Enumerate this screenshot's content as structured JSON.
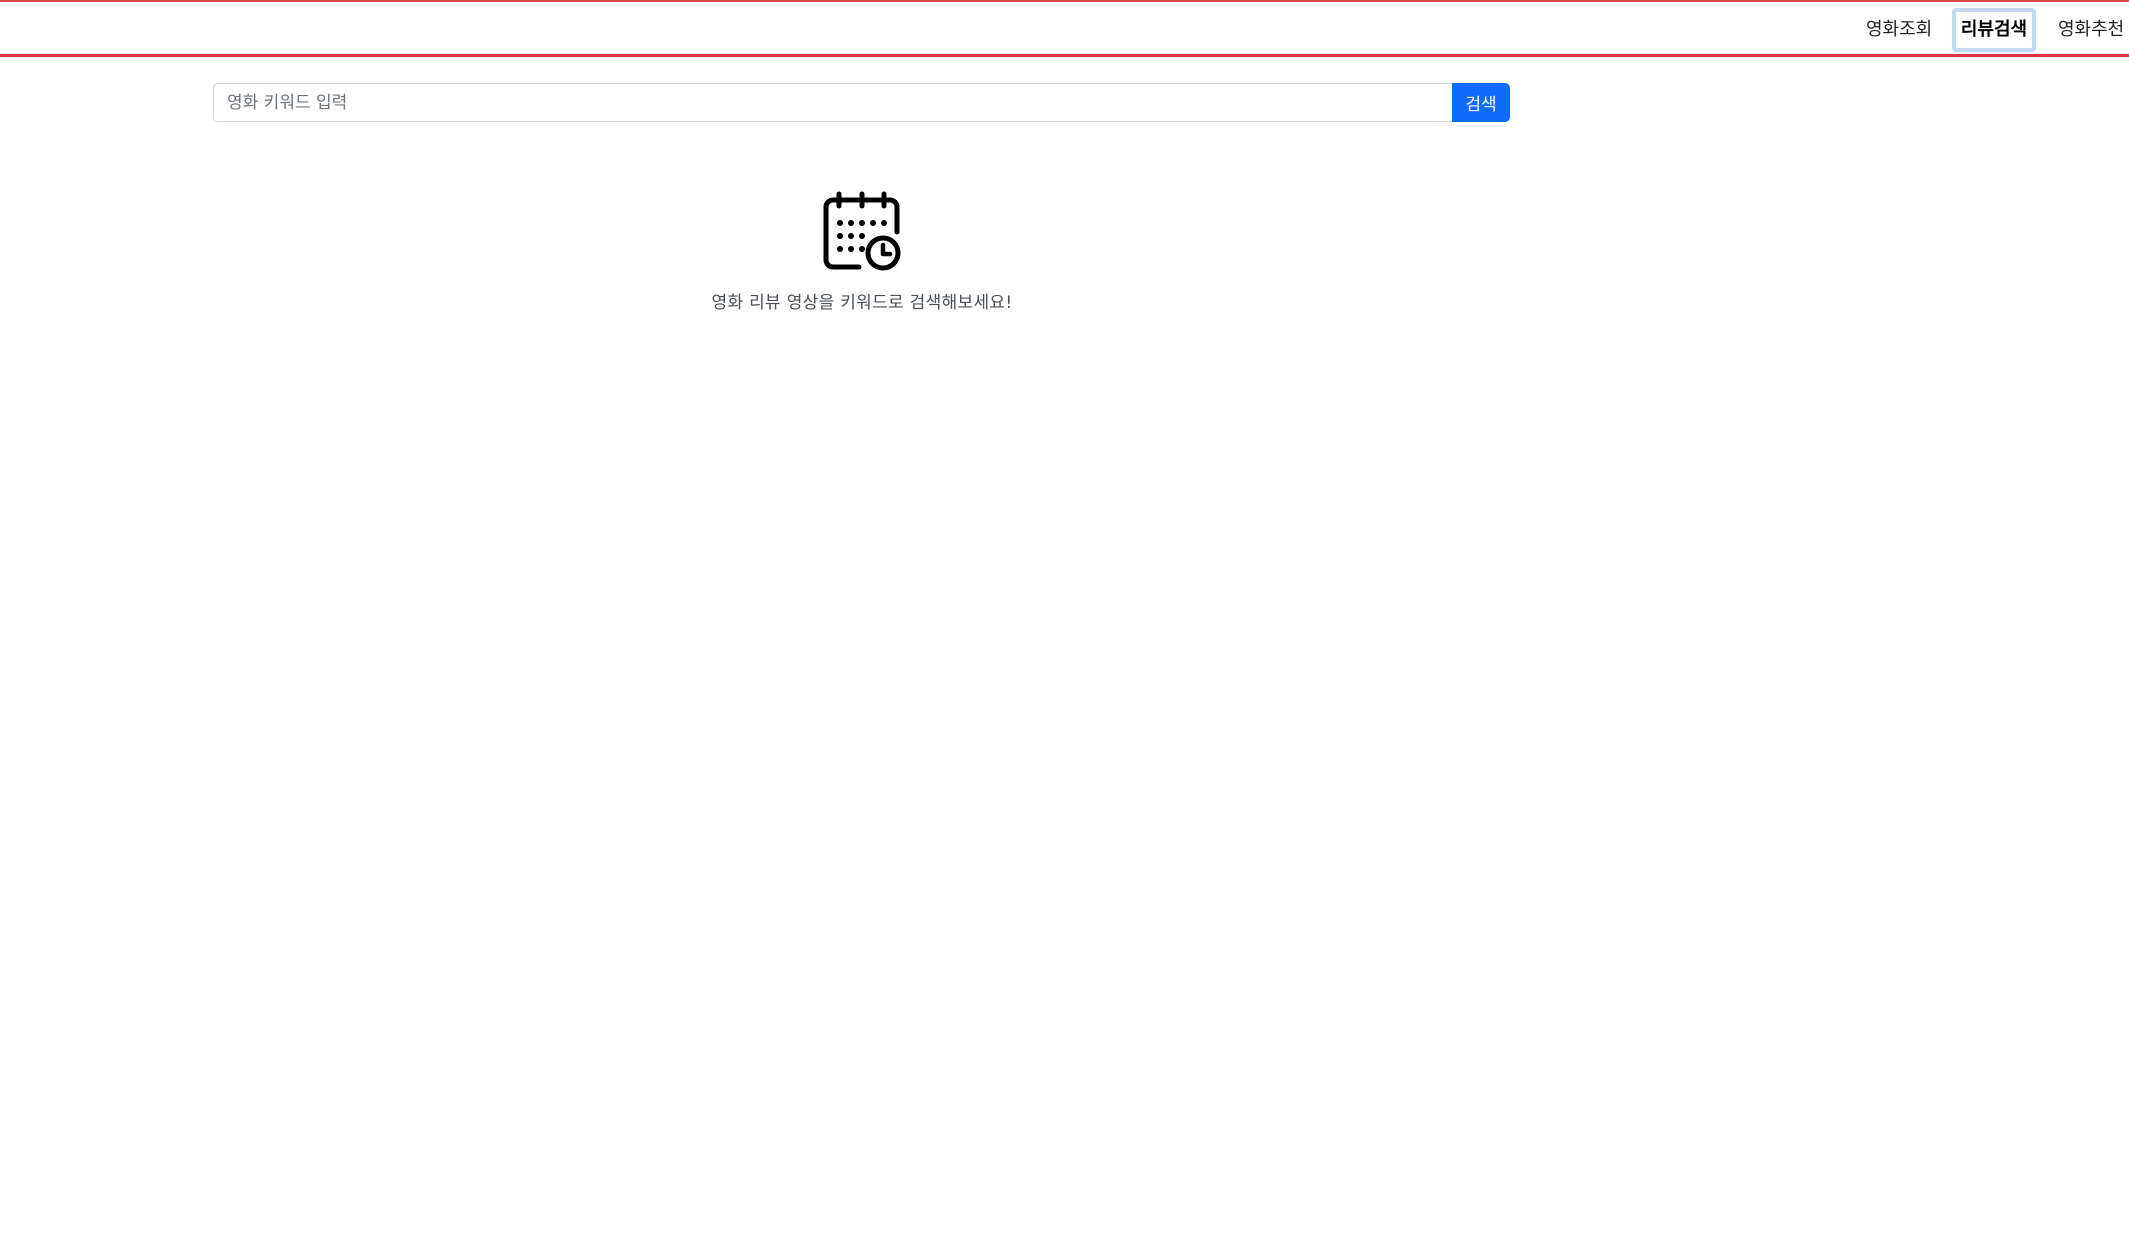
{
  "nav": {
    "items": [
      {
        "label": "영화조회",
        "active": false
      },
      {
        "label": "리뷰검색",
        "active": true
      },
      {
        "label": "영화추천",
        "active": false
      }
    ]
  },
  "search": {
    "placeholder": "영화 키워드 입력",
    "value": "",
    "button_label": "검색"
  },
  "empty_state": {
    "icon": "calendar-clock-icon",
    "message": "영화 리뷰 영상을 키워드로 검색해보세요!"
  },
  "colors": {
    "accent_line": "#dc3545",
    "primary_button": "#0d6efd",
    "active_outline": "#c2d9f5"
  }
}
